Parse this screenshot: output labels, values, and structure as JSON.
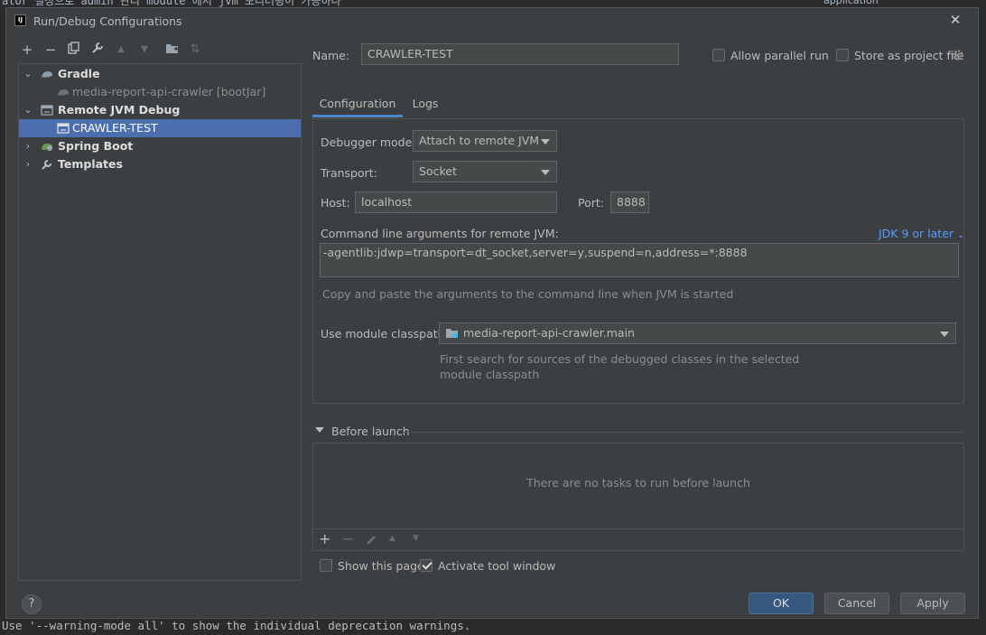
{
  "background": {
    "top_text": "ator 설정으로 admin 관리 module 에서 jvm 모니터링이 가능하다",
    "top_right_node": "application",
    "bottom_text": "Use '--warning-mode all' to show the individual deprecation warnings."
  },
  "dialog": {
    "title": "Run/Debug Configurations",
    "app_icon_text": "IJ"
  },
  "toolbar": {
    "add": "+",
    "remove": "−",
    "copy": "⧉",
    "edit": "🔧",
    "up": "▲",
    "down": "▼",
    "folder": "📁",
    "sort": "⇅"
  },
  "tree": [
    {
      "label": "Gradle",
      "arrow": "⌄",
      "icon": "gradle-icon",
      "bold": true
    },
    {
      "label": "media-report-api-crawler [bootJar]",
      "icon": "gradle-icon",
      "muted": true
    },
    {
      "label": "Remote JVM Debug",
      "arrow": "⌄",
      "icon": "remote-debug-icon",
      "bold": true
    },
    {
      "label": "CRAWLER-TEST",
      "icon": "remote-debug-icon",
      "selected": true
    },
    {
      "label": "Spring Boot",
      "arrow": "›",
      "icon": "spring-boot-icon",
      "bold": true
    },
    {
      "label": "Templates",
      "arrow": "›",
      "icon": "wrench-icon",
      "bold": true
    }
  ],
  "form": {
    "name_label": "Name:",
    "name_value": "CRAWLER-TEST",
    "allow_parallel": "Allow parallel run",
    "store_as_project": "Store as project file",
    "tabs": [
      "Configuration",
      "Logs"
    ],
    "debugger_mode_label": "Debugger mode:",
    "debugger_mode_value": "Attach to remote JVM",
    "transport_label": "Transport:",
    "transport_value": "Socket",
    "host_label": "Host:",
    "host_value": "localhost",
    "port_label": "Port:",
    "port_value": "8888",
    "cmd_label": "Command line arguments for remote JVM:",
    "jdk_link": "JDK 9 or later",
    "cmd_value": "-agentlib:jdwp=transport=dt_socket,server=y,suspend=n,address=*:8888",
    "cmd_hint": "Copy and paste the arguments to the command line when JVM is started",
    "classpath_label": "Use module classpath:",
    "classpath_value": "media-report-api-crawler.main",
    "classpath_hint_1": "First search for sources of the debugged classes in the selected",
    "classpath_hint_2": "module classpath"
  },
  "before_launch": {
    "title": "Before launch",
    "empty": "There are no tasks to run before launch",
    "show_page": "Show this page",
    "activate_tool_window": "Activate tool window"
  },
  "buttons": {
    "help": "?",
    "ok": "OK",
    "cancel": "Cancel",
    "apply": "Apply"
  },
  "colors": {
    "dialog_bg": "#3c3f41",
    "selection": "#4b6eaf",
    "link": "#589df6",
    "primary_button": "#365880"
  }
}
